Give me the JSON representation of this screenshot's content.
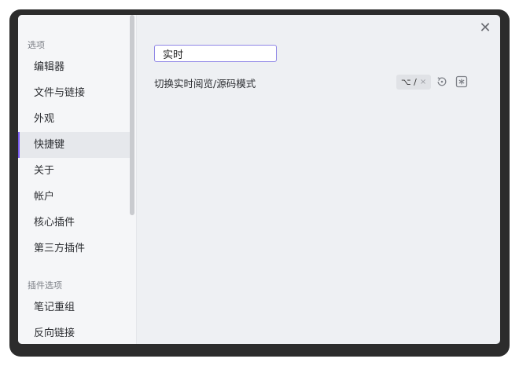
{
  "sidebar": {
    "sections": [
      {
        "title": "选项",
        "items": [
          "编辑器",
          "文件与链接",
          "外观",
          "快捷键",
          "关于",
          "帐户",
          "核心插件",
          "第三方插件"
        ]
      },
      {
        "title": "插件选项",
        "items": [
          "笔记重组",
          "反向链接"
        ]
      }
    ],
    "active_item": "快捷键"
  },
  "search": {
    "value": "实时"
  },
  "hotkeys": [
    {
      "name": "切换实时阅览/源码模式",
      "shortcut": "⌥ /",
      "remove": "×"
    }
  ],
  "close": "✕",
  "colors": {
    "accent": "#7a5cf0"
  }
}
